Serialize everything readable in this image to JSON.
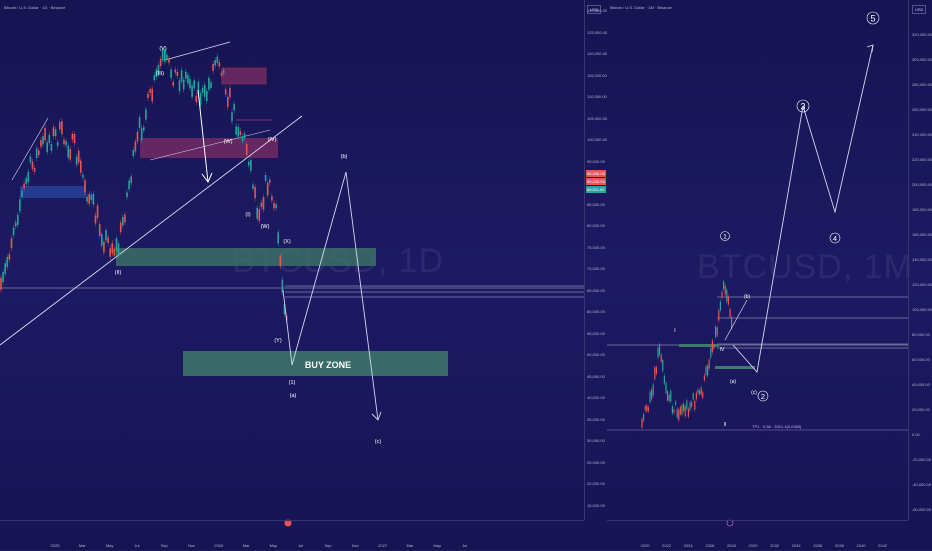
{
  "left": {
    "header": "Bitcoin / U.S. Dollar · 1D · Binance",
    "watermark": "BTCUSD, 1D",
    "currency": "USD",
    "buy_zone_label": "BUY ZONE",
    "y_ticks": [
      "130,000.00",
      "125,000.00",
      "120,000.00",
      "115,000.00",
      "110,000.00",
      "105,000.00",
      "100,000.00",
      "95,000.00",
      "90,000.00",
      "85,000.00",
      "80,000.00",
      "75,000.00",
      "70,000.00",
      "65,000.00",
      "60,000.00",
      "55,000.00",
      "50,000.00",
      "45,000.00",
      "40,000.00",
      "35,000.00",
      "30,000.00",
      "25,000.00",
      "20,000.00",
      "15,000.00"
    ],
    "x_ticks": [
      "2025",
      "Mar",
      "May",
      "Jul",
      "Sep",
      "Nov",
      "2026",
      "Mar",
      "May",
      "Jul",
      "Sep",
      "Nov",
      "2027",
      "Mar",
      "May",
      "Jul"
    ],
    "price_labels": [
      "96,456.00",
      "93,230.00",
      "88,511.00"
    ],
    "wave_labels": {
      "b": "(b)",
      "a": "(a)",
      "c": "(c)",
      "one": "(1)",
      "w": "(W)",
      "x": "(X)",
      "y": "(Y)",
      "i": "(I)",
      "ii": "(II)",
      "iii": "(III)",
      "iv": "(IV)",
      "v": "(V)"
    }
  },
  "right": {
    "header": "Bitcoin / U.S. Dollar · 1M · Binance",
    "watermark": "BTCUSD, 1M",
    "currency": "USD",
    "fib_label": "TP1 · 0.38 · 2021.1(0.0383)",
    "y_ticks": [
      "320,000.00",
      "300,000.00",
      "280,000.00",
      "260,000.00",
      "240,000.00",
      "220,000.00",
      "200,000.00",
      "180,000.00",
      "160,000.00",
      "140,000.00",
      "120,000.00",
      "100,000.00",
      "80,000.00",
      "60,000.00",
      "40,000.00",
      "20,000.00",
      "0.00",
      "-20,000.00",
      "-40,000.00",
      "-60,000.00"
    ],
    "x_ticks": [
      "2020",
      "2022",
      "2024",
      "2026",
      "2028",
      "2030",
      "2032",
      "2034",
      "2036",
      "2038",
      "2040",
      "2042"
    ],
    "waves": {
      "one": "1",
      "two": "2",
      "three": "3",
      "four": "4",
      "five": "5",
      "a": "(a)",
      "b": "(b)",
      "c": "(c)",
      "I": "I",
      "II": "II",
      "IV": "IV"
    }
  },
  "colors": {
    "background": "#1c1960",
    "up": "#26a69a",
    "down": "#ef5350",
    "zone": "#3d7a6a",
    "line": "#d9d9ee",
    "pink_zone": "#a23468"
  },
  "chart_data": [
    {
      "type": "line",
      "title": "",
      "xlabel": "",
      "ylabel": "",
      "ylim": [
        15000,
        132000
      ],
      "x": [
        "2025-01",
        "2025-03",
        "2025-05",
        "2025-07",
        "2025-09",
        "2025-11",
        "2026-01",
        "2026-03"
      ],
      "series": [
        {
          "values": [
            94000,
            82000,
            96000,
            117000,
            110000,
            96000,
            90000,
            72000
          ]
        }
      ],
      "buy_zone": [
        53000,
        47000
      ],
      "projection": {
        "x": [
          "2026-03",
          "2026-06",
          "2026-09"
        ],
        "values": [
          55000,
          100000,
          33000
        ]
      }
    },
    {
      "type": "line",
      "title": "",
      "xlabel": "",
      "ylabel": "",
      "ylim": [
        -60000,
        330000
      ],
      "x": [
        "2020",
        "2021",
        "2022",
        "2023",
        "2024",
        "2025",
        "2026",
        "2027",
        "2028",
        "2030",
        "2032",
        "2034",
        "2036",
        "2038"
      ],
      "series": [
        {
          "values": [
            10000,
            60000,
            20000,
            30000,
            65000,
            105000,
            75000,
            50000,
            60000,
            150000,
            260000,
            170000,
            210000,
            310000
          ]
        }
      ]
    }
  ]
}
